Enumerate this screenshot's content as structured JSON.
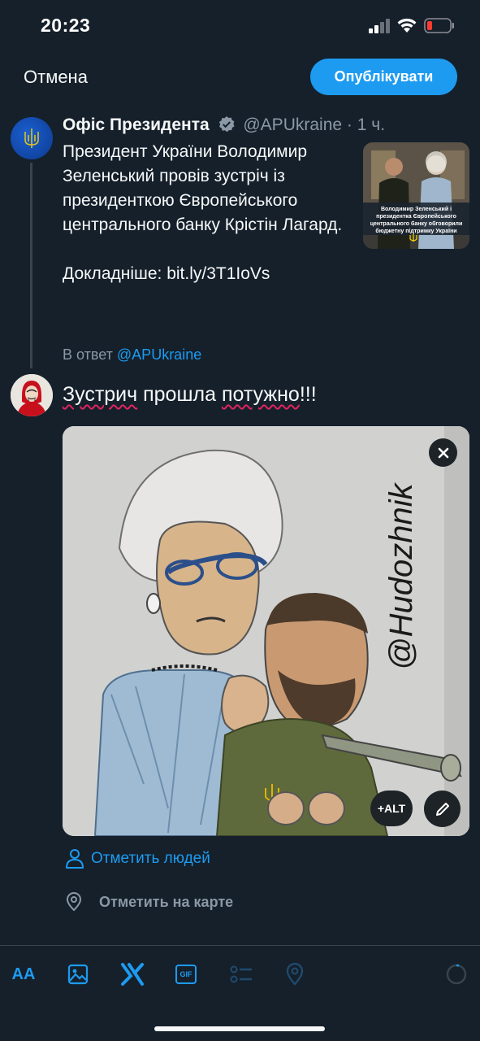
{
  "status_bar": {
    "time": "20:23"
  },
  "header": {
    "cancel_label": "Отмена",
    "publish_label": "Опублікувати"
  },
  "quoted_tweet": {
    "author_name": "Офіс Президента",
    "author_handle": "@APUkraine",
    "separator": "·",
    "time_ago": "1 ч.",
    "text": "Президент України Володимир Зеленський провів зустріч із президенткою Європейського центрального банку Крістін Лагард.\n\nДокладніше: bit.ly/3T1IoVs",
    "thumbnail_caption": "Володимир Зеленський і президентка Європейського центрального банку обговорили бюджетну підтримку України"
  },
  "reply": {
    "prefix": "В ответ",
    "mention": "@APUkraine"
  },
  "composer": {
    "text_word1": "Зустрич",
    "text_word2": " прошла ",
    "text_word3": "потужно",
    "text_word4": "!!!",
    "image_signature": "@Hudozhnik"
  },
  "media_actions": {
    "alt_label": "+ALT"
  },
  "tags": {
    "people_label": "Отметить людей",
    "location_label": "Отметить на карте"
  },
  "toolbar": {
    "text_format_label": "AA",
    "gif_label": "GIF"
  },
  "colors": {
    "background": "#15202b",
    "accent": "#1d9bf0",
    "secondary_text": "#8b98a5",
    "battery_low": "#ff3b30"
  }
}
